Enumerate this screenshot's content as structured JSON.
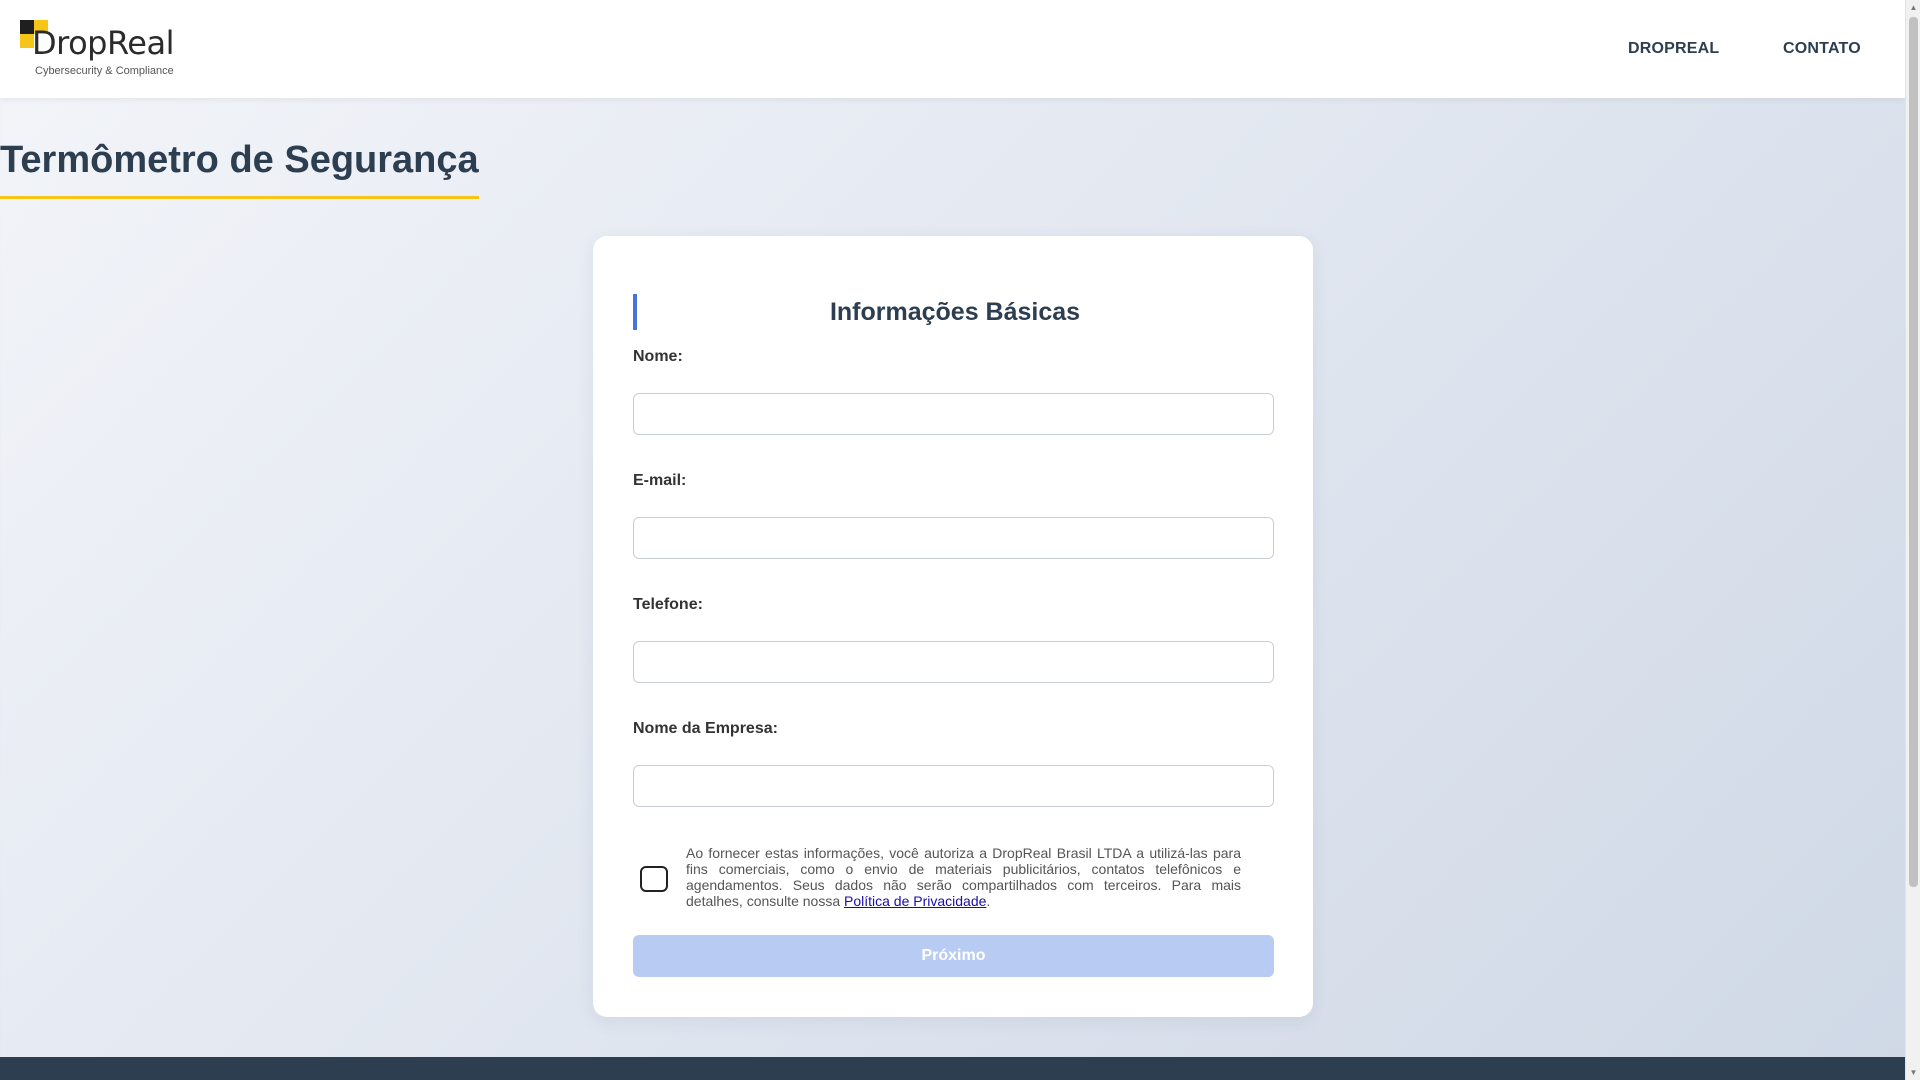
{
  "header": {
    "logo": {
      "name": "DropReal",
      "tagline": "Cybersecurity & Compliance"
    },
    "nav": [
      {
        "label": "DROPREAL"
      },
      {
        "label": "CONTATO"
      }
    ]
  },
  "page": {
    "title": "Termômetro de Segurança"
  },
  "form": {
    "section_title": "Informações Básicas",
    "fields": [
      {
        "label": "Nome:",
        "value": "",
        "placeholder": ""
      },
      {
        "label": "E-mail:",
        "value": "",
        "placeholder": ""
      },
      {
        "label": "Telefone:",
        "value": "",
        "placeholder": ""
      },
      {
        "label": "Nome da Empresa:",
        "value": "",
        "placeholder": ""
      }
    ],
    "consent": {
      "text": "Ao fornecer estas informações, você autoriza a DropReal Brasil LTDA a utilizá-las para fins comerciais, como o envio de materiais publicitários, contatos telefônicos e agendamentos. Seus dados não serão compartilhados com terceiros. Para mais detalhes, consulte nossa ",
      "link_label": "Política de Privacidade",
      "suffix": ".",
      "checked": false
    },
    "next_button": "Próximo"
  },
  "colors": {
    "accent_yellow": "#f5c518",
    "accent_blue": "#4b73d8",
    "title_text": "#2c3e50",
    "button_disabled": "#b8cbf2",
    "footer": "#2c3e50"
  }
}
